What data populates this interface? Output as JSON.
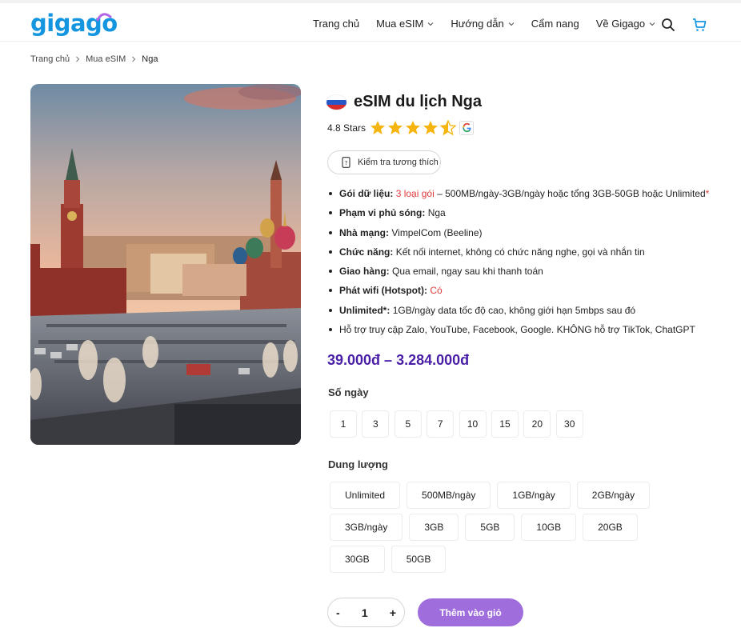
{
  "brand": {
    "logo_text": "gigago"
  },
  "nav": {
    "items": [
      {
        "label": "Trang chủ",
        "has_dropdown": false
      },
      {
        "label": "Mua eSIM",
        "has_dropdown": true
      },
      {
        "label": "Hướng dẫn",
        "has_dropdown": true
      },
      {
        "label": "Cẩm nang",
        "has_dropdown": false
      },
      {
        "label": "Về Gigago",
        "has_dropdown": true
      }
    ],
    "icons": [
      "search-icon",
      "cart-icon"
    ]
  },
  "breadcrumb": [
    "Trang chủ",
    "Mua eSIM",
    "Nga"
  ],
  "product": {
    "flag": "russia",
    "title": "eSIM du lịch Nga",
    "rating_text": "4.8 Stars",
    "rating_value": 4.5,
    "compat_button": "Kiểm tra tương thích",
    "features": [
      {
        "key": "Gói dữ liệu:",
        "highlight": "3 loại gói",
        "value": "– 500MB/ngày-3GB/ngày hoặc tổng 3GB-50GB hoặc Unlimited",
        "mark": "*"
      },
      {
        "key": "Phạm vi phủ sóng:",
        "value": "Nga"
      },
      {
        "key": "Nhà mạng:",
        "value": "VimpelCom (Beeline)"
      },
      {
        "key": "Chức năng:",
        "value": "Kết nối internet, không có chức năng nghe, gọi và nhắn tin"
      },
      {
        "key": "Giao hàng:",
        "value": "Qua email, ngay sau khi thanh toán"
      },
      {
        "key": "Phát wifi (Hotspot):",
        "highlight": "Có"
      },
      {
        "key": "Unlimited*:",
        "value": "1GB/ngày data tốc độ cao, không giới hạn 5mbps sau đó"
      },
      {
        "value": "Hỗ trợ truy cập Zalo, YouTube, Facebook, Google. KHÔNG hỗ trợ TikTok, ChatGPT"
      }
    ],
    "price": "39.000đ – 3.284.000đ",
    "days_label": "Số ngày",
    "days": [
      "1",
      "3",
      "5",
      "7",
      "10",
      "15",
      "20",
      "30"
    ],
    "capacity_label": "Dung lượng",
    "capacities": [
      "Unlimited",
      "500MB/ngày",
      "1GB/ngày",
      "2GB/ngày",
      "3GB/ngày",
      "3GB",
      "5GB",
      "10GB",
      "20GB",
      "30GB",
      "50GB"
    ],
    "quantity": {
      "minus": "-",
      "value": "1",
      "plus": "+"
    },
    "add_to_cart": "Thêm vào giỏ"
  },
  "colors": {
    "brand_blue": "#1495e0",
    "price_purple": "#4a1fa8",
    "button_purple": "#a06ddc",
    "highlight_red": "#e03a3a",
    "star": "#f6b40e"
  }
}
